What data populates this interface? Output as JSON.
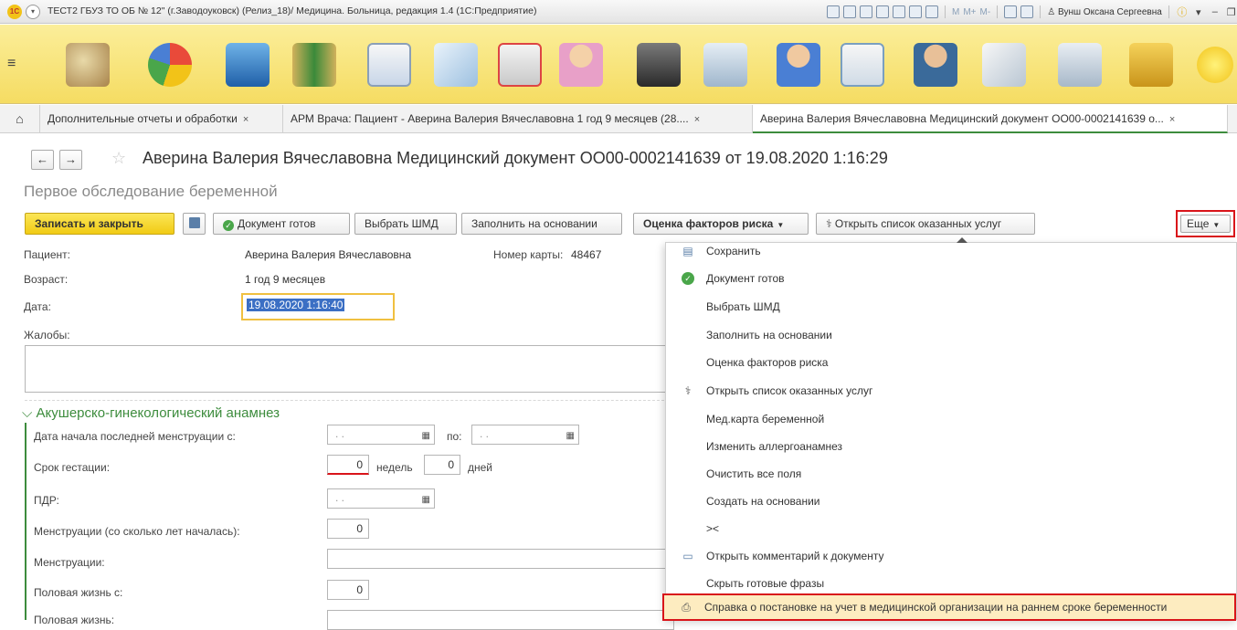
{
  "titlebar": {
    "logo_text": "1C",
    "title": "ТЕСТ2 ГБУЗ ТО ОБ № 12\" (г.Заводоуковск) (Релиз_18)/ Медицина. Больница, редакция 1.4 (1С:Предприятие)",
    "memory_buttons": [
      "M",
      "M+",
      "M-"
    ],
    "user": "Вунш Оксана Сергеевна"
  },
  "tabs": [
    {
      "label": "Дополнительные отчеты и обработки",
      "close": "×"
    },
    {
      "label": "АРМ Врача: Пациент - Аверина Валерия Вячеславовна 1 год 9 месяцев (28....",
      "close": "×"
    },
    {
      "label": "Аверина Валерия Вячеславовна Медицинский документ ОО00-0002141639 о...",
      "close": "×"
    }
  ],
  "header": {
    "title": "Аверина Валерия Вячеславовна Медицинский документ ОО00-0002141639 от 19.08.2020 1:16:29",
    "subtitle": "Первое обследование беременной"
  },
  "toolbar": {
    "save_close": "Записать и закрыть",
    "doc_ready": "Документ готов",
    "choose_shmd": "Выбрать ШМД",
    "fill_based": "Заполнить на основании",
    "risk_eval": "Оценка факторов риска",
    "open_services": "Открыть список оказанных услуг",
    "more": "Еще"
  },
  "form": {
    "patient_label": "Пациент:",
    "patient_value": "Аверина Валерия Вячеславовна",
    "card_label": "Номер карты:",
    "card_value": "48467",
    "age_label": "Возраст:",
    "age_value": "1 год 9 месяцев",
    "date_label": "Дата:",
    "date_value": "19.08.2020  1:16:40",
    "complaints_label": "Жалобы:",
    "anamnesis_title": "Акушерско-гинекологический анамнез",
    "lmp_label": "Дата начала последней менструации с:",
    "lmp_from_placeholder": " .  .",
    "lmp_to_label": "по:",
    "lmp_to_placeholder": " .  .",
    "gestation_label": "Срок гестации:",
    "gestation_weeks": "0",
    "weeks_label": "недель",
    "gestation_days": "0",
    "days_label": "дней",
    "pdr_label": "ПДР:",
    "pdr_placeholder": " .  .",
    "menarche_label": "Менструации (со сколько лет началась):",
    "menarche_value": "0",
    "menstruation_label": "Менструации:",
    "sexlife_label": "Половая жизнь с:",
    "sexlife_value": "0",
    "sexlife2_label": "Половая жизнь:"
  },
  "dropdown": {
    "items": [
      {
        "label": "Сохранить",
        "icon": "save-icon"
      },
      {
        "label": "Документ готов",
        "icon": "check-icon"
      },
      {
        "label": "Выбрать ШМД",
        "icon": ""
      },
      {
        "label": "Заполнить на основании",
        "icon": ""
      },
      {
        "label": "Оценка факторов риска",
        "icon": ""
      },
      {
        "label": "Открыть список оказанных услуг",
        "icon": "doctor-icon"
      },
      {
        "label": "Мед.карта беременной",
        "icon": ""
      },
      {
        "label": "Изменить аллергоанамнез",
        "icon": ""
      },
      {
        "label": "Очистить все поля",
        "icon": ""
      },
      {
        "label": "Создать на основании",
        "icon": ""
      },
      {
        "label": "><",
        "icon": ""
      },
      {
        "label": "Открыть комментарий к документу",
        "icon": "comment-icon"
      },
      {
        "label": "Скрыть готовые фразы",
        "icon": ""
      },
      {
        "label": "Справка о постановке на учет в медицинской организации на раннем сроке беременности",
        "icon": "print-icon"
      }
    ]
  },
  "colors": {
    "accent_green": "#3d8c3d",
    "highlight_red": "#d9141a",
    "primary_yellow": "#f1cb14",
    "date_selection": "#3b6fc4"
  }
}
